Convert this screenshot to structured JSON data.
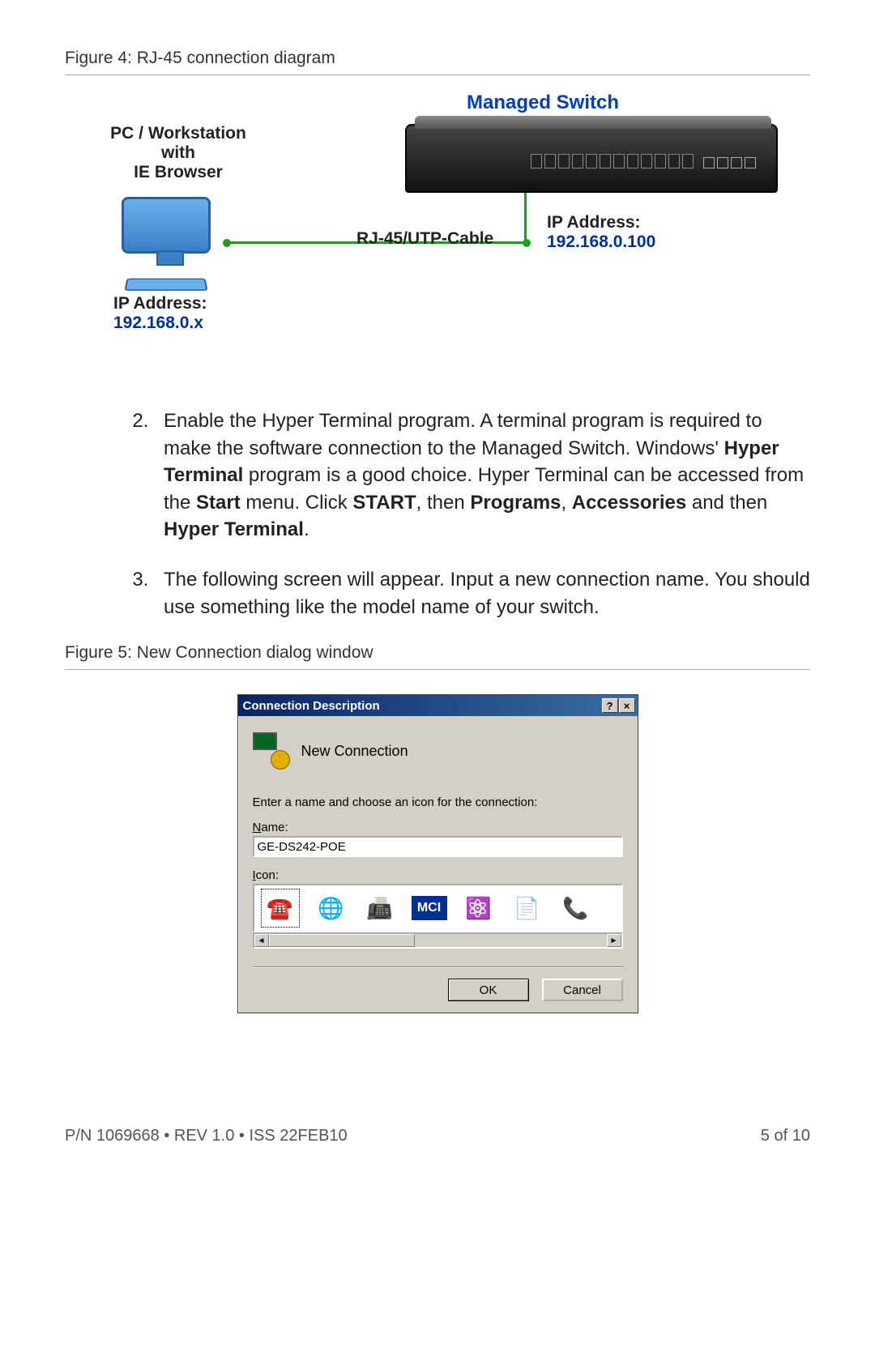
{
  "fig4": {
    "caption": "Figure 4: RJ-45 connection diagram",
    "switch_label": "Managed Switch",
    "pc_label_l1": "PC / Workstation",
    "pc_label_l2": "with",
    "pc_label_l3": "IE Browser",
    "cable_label": "RJ-45/UTP-Cable",
    "ip_label": "IP Address:",
    "ip_pc": "192.168.0.x",
    "ip_switch": "192.168.0.100"
  },
  "steps": {
    "item2_a": "Enable the Hyper Terminal program. A terminal program is required to make the software connection to the Managed Switch. Windows' ",
    "item2_b1": "Hyper Terminal",
    "item2_c": " program is a good choice. Hyper Terminal can be accessed from the ",
    "item2_b2": "Start",
    "item2_d": " menu. Click ",
    "item2_b3": "START",
    "item2_e": ", then ",
    "item2_b4": "Programs",
    "item2_f": ", ",
    "item2_b5": "Accessories",
    "item2_g": " and then ",
    "item2_b6": "Hyper Terminal",
    "item2_h": ".",
    "item3": "The following screen will appear. Input a new connection name. You should use something like the model name of your switch."
  },
  "fig5": {
    "caption": "Figure 5: New Connection dialog window",
    "title": "Connection Description",
    "help_btn": "?",
    "close_btn": "×",
    "heading": "New Connection",
    "instruction": "Enter a name and choose an icon for the connection:",
    "name_label_u": "N",
    "name_label_r": "ame:",
    "name_value": "GE-DS242-POE",
    "icon_label_u": "I",
    "icon_label_r": "con:",
    "scroll_left": "◄",
    "scroll_right": "►",
    "mci": "MCI",
    "ok": "OK",
    "cancel": "Cancel"
  },
  "footer": {
    "left": "P/N 1069668 • REV 1.0 • ISS 22FEB10",
    "right": "5 of 10"
  }
}
